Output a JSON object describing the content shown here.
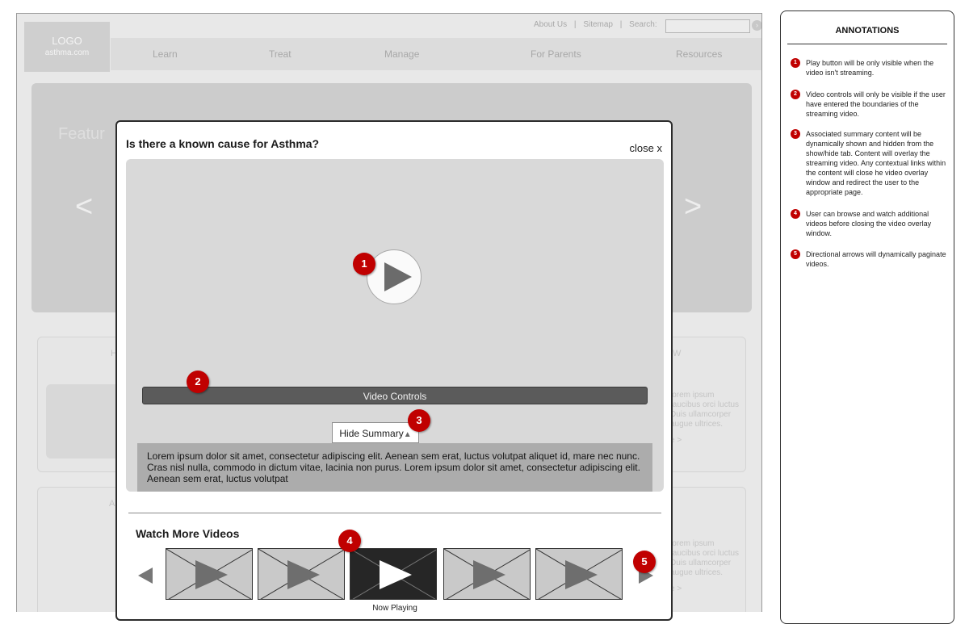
{
  "site": {
    "logo": {
      "title": "LOGO",
      "subtitle": "asthma.com"
    },
    "top_links": [
      "About Us",
      "Sitemap",
      "Search:"
    ],
    "nav": [
      "Learn",
      "Treat",
      "Manage",
      "For Parents",
      "Resources"
    ],
    "hero": {
      "featured_text": "Featur",
      "prev_arrow": "<",
      "next_arrow": ">"
    },
    "panel_fragments": {
      "top_left_head": "H",
      "top_right_head": "W",
      "bottom_left_head": "A",
      "top_right_lines": [
        "lorem ipsum",
        "faucibus orci luctus",
        "Duis ullamcorper",
        "augue ultrices."
      ],
      "top_right_more": "e >",
      "bottom_right_lines": [
        "lorem ipsum",
        "faucibus orci luctus",
        "Duis ullamcorper",
        "augue ultrices."
      ],
      "bottom_right_more": "e >"
    }
  },
  "modal": {
    "title": "Is there a known cause for Asthma?",
    "close_label": "close x",
    "video_controls_label": "Video Controls",
    "hide_summary_label": "Hide Summary",
    "summary_text": "Lorem ipsum dolor sit amet, consectetur adipiscing elit. Aenean sem erat, luctus volutpat aliquet id, mare nec nunc. Cras nisl nulla, commodo in dictum vitae, lacinia non purus. Lorem ipsum dolor sit amet, consectetur adipiscing elit. Aenean sem erat, luctus volutpat",
    "watch_more_title": "Watch More Videos",
    "now_playing_label": "Now Playing"
  },
  "badges": [
    "1",
    "2",
    "3",
    "4",
    "5"
  ],
  "annotations": {
    "title": "ANNOTATIONS",
    "notes": [
      {
        "num": "1",
        "text": "Play button will be only visible when the video isn't streaming."
      },
      {
        "num": "2",
        "text": "Video controls will only be visible if the user have entered the boundaries of the streaming video."
      },
      {
        "num": "3",
        "text": "Associated summary content will be dynamically shown and hidden from the show/hide tab. Content will overlay the streaming video. Any contextual links within the content will close he video overlay window and redirect the user to the appropriate page."
      },
      {
        "num": "4",
        "text": "User can browse and watch additional videos before closing the video overlay window."
      },
      {
        "num": "5",
        "text": "Directional arrows will dynamically paginate videos."
      }
    ]
  },
  "colors": {
    "badge_red": "#c00000",
    "video_bg": "#d9d9d9",
    "controls": "#5b5b5b"
  }
}
